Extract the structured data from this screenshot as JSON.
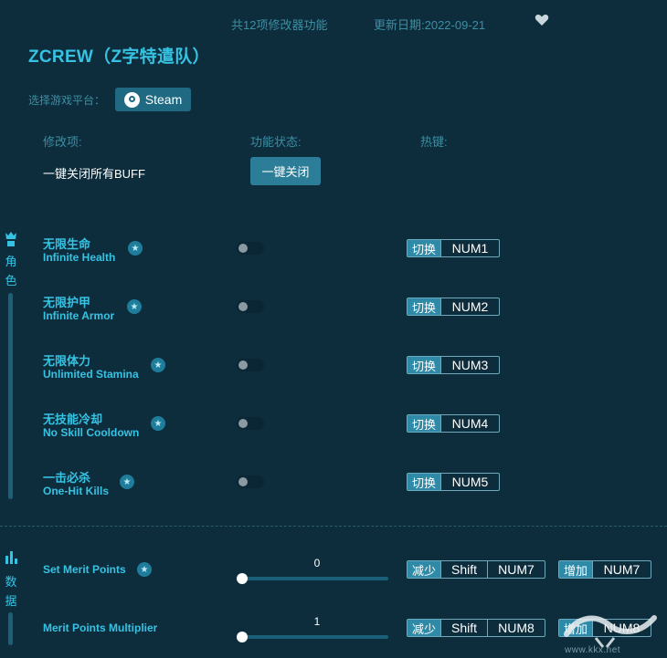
{
  "header": {
    "feature_count": "共12项修改器功能",
    "update_date": "更新日期:2022-09-21",
    "title": "ZCREW（Z字特遣队）"
  },
  "platform": {
    "label": "选择游戏平台：",
    "button": "Steam"
  },
  "columns": {
    "mod": "修改项:",
    "status": "功能状态:",
    "hotkey": "热键:"
  },
  "buff": {
    "label": "一键关闭所有BUFF",
    "button": "一键关闭"
  },
  "sections": {
    "character": "角色",
    "data": "数据"
  },
  "features": [
    {
      "cn": "无限生命",
      "en": "Infinite Health",
      "action": "切换",
      "key": "NUM1"
    },
    {
      "cn": "无限护甲",
      "en": "Infinite Armor",
      "action": "切换",
      "key": "NUM2"
    },
    {
      "cn": "无限体力",
      "en": "Unlimited Stamina",
      "action": "切换",
      "key": "NUM3"
    },
    {
      "cn": "无技能冷却",
      "en": "No Skill Cooldown",
      "action": "切换",
      "key": "NUM4"
    },
    {
      "cn": "一击必杀",
      "en": "One-Hit Kills",
      "action": "切换",
      "key": "NUM5"
    }
  ],
  "sliders": [
    {
      "en": "Set Merit Points",
      "value": "0",
      "dec_action": "减少",
      "dec_mod": "Shift",
      "dec_key": "NUM7",
      "inc_action": "增加",
      "inc_key": "NUM7"
    },
    {
      "en": "Merit Points Multiplier",
      "value": "1",
      "dec_action": "减少",
      "dec_mod": "Shift",
      "dec_key": "NUM8",
      "inc_action": "增加",
      "inc_key": "NUM8"
    }
  ],
  "watermark": "www.kkx.net",
  "colors": {
    "background": "#0d2d3d",
    "accent": "#36c3e3",
    "button": "#2c7d98"
  }
}
